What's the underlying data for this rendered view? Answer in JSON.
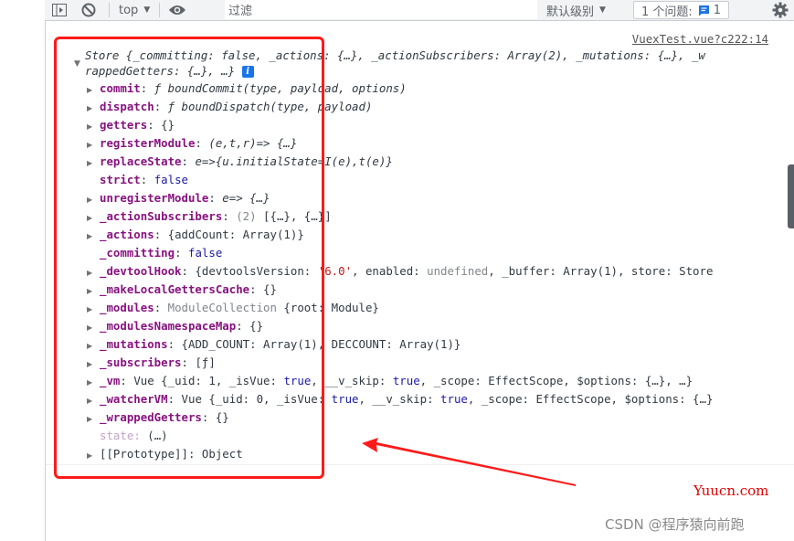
{
  "toolbar": {
    "context": "top",
    "filter_placeholder": "过滤",
    "levels": "默认级别",
    "issues_label": "1 个问题:",
    "issues_count": "1"
  },
  "console": {
    "source_link": "VuexTest.vue?c222:14",
    "summary_line1": "Store {_committing: false, _actions: {…}, _actionSubscribers: Array(2), _mutations: {…}, _w",
    "summary_line2": "rappedGetters: {…}, …}",
    "rows": [
      {
        "key": "commit",
        "value": "ƒ boundCommit(type, payload, options)",
        "expandable": true
      },
      {
        "key": "dispatch",
        "value": "ƒ boundDispatch(type, payload)",
        "expandable": true
      },
      {
        "key": "getters",
        "value": "{}",
        "expandable": true
      },
      {
        "key": "registerModule",
        "value": "(e,t,r)=> {…}",
        "expandable": true
      },
      {
        "key": "replaceState",
        "value": "e=>{u.initialState=I(e),t(e)}",
        "expandable": true
      },
      {
        "key": "strict",
        "value": "false",
        "expandable": false
      },
      {
        "key": "unregisterModule",
        "value": "e=> {…}",
        "expandable": true
      },
      {
        "key": "_actionSubscribers",
        "value": "(2) [{…}, {…}]",
        "expandable": true
      },
      {
        "key": "_actions",
        "value": "{addCount: Array(1)}",
        "expandable": true
      },
      {
        "key": "_committing",
        "value": "false",
        "expandable": false
      },
      {
        "key": "_devtoolHook",
        "value": "{devtoolsVersion: '6.0', enabled: undefined, _buffer: Array(1), store: Store",
        "expandable": true
      },
      {
        "key": "_makeLocalGettersCache",
        "value": "{}",
        "expandable": true
      },
      {
        "key": "_modules",
        "value": "ModuleCollection {root: Module}",
        "expandable": true
      },
      {
        "key": "_modulesNamespaceMap",
        "value": "{}",
        "expandable": true
      },
      {
        "key": "_mutations",
        "value": "{ADD_COUNT: Array(1), DECCOUNT: Array(1)}",
        "expandable": true
      },
      {
        "key": "_subscribers",
        "value": "[ƒ]",
        "expandable": true
      },
      {
        "key": "_vm",
        "value": "Vue {_uid: 1, _isVue: true, __v_skip: true, _scope: EffectScope, $options: {…}, …}",
        "expandable": true
      },
      {
        "key": "_watcherVM",
        "value": "Vue {_uid: 0, _isVue: true, __v_skip: true, _scope: EffectScope, $options: {…}",
        "expandable": true
      },
      {
        "key": "_wrappedGetters",
        "value": "{}",
        "expandable": true
      },
      {
        "key": "state",
        "value": "(…)",
        "expandable": false
      },
      {
        "key": "[[Prototype]]",
        "value": "Object",
        "expandable": true
      }
    ]
  },
  "watermarks": {
    "site": "Yuucn.com",
    "author": "CSDN @程序猿向前跑"
  },
  "colors": {
    "annotation_red": "#ff1a1a",
    "issue_blue": "#1a73e8"
  }
}
